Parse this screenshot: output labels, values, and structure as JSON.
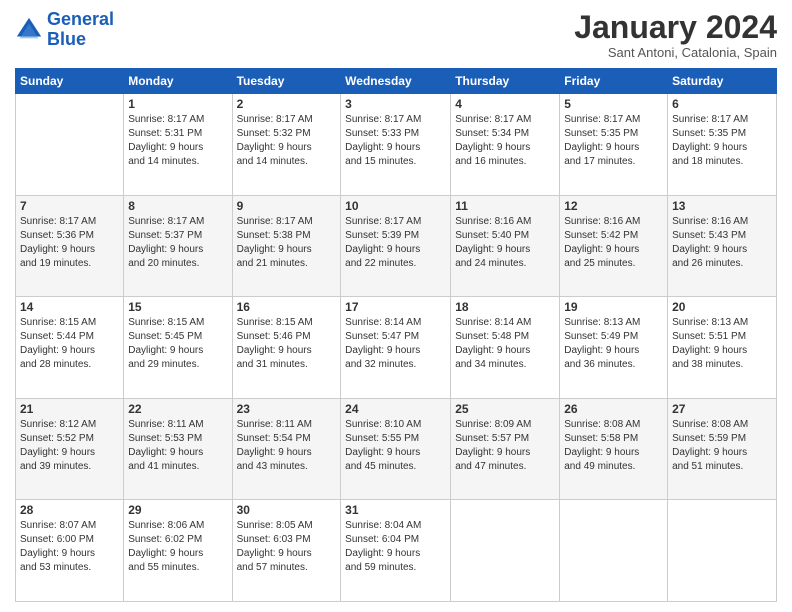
{
  "logo": {
    "line1": "General",
    "line2": "Blue"
  },
  "header": {
    "title": "January 2024",
    "location": "Sant Antoni, Catalonia, Spain"
  },
  "days_of_week": [
    "Sunday",
    "Monday",
    "Tuesday",
    "Wednesday",
    "Thursday",
    "Friday",
    "Saturday"
  ],
  "weeks": [
    [
      {
        "day": "",
        "info": ""
      },
      {
        "day": "1",
        "info": "Sunrise: 8:17 AM\nSunset: 5:31 PM\nDaylight: 9 hours\nand 14 minutes."
      },
      {
        "day": "2",
        "info": "Sunrise: 8:17 AM\nSunset: 5:32 PM\nDaylight: 9 hours\nand 14 minutes."
      },
      {
        "day": "3",
        "info": "Sunrise: 8:17 AM\nSunset: 5:33 PM\nDaylight: 9 hours\nand 15 minutes."
      },
      {
        "day": "4",
        "info": "Sunrise: 8:17 AM\nSunset: 5:34 PM\nDaylight: 9 hours\nand 16 minutes."
      },
      {
        "day": "5",
        "info": "Sunrise: 8:17 AM\nSunset: 5:35 PM\nDaylight: 9 hours\nand 17 minutes."
      },
      {
        "day": "6",
        "info": "Sunrise: 8:17 AM\nSunset: 5:35 PM\nDaylight: 9 hours\nand 18 minutes."
      }
    ],
    [
      {
        "day": "7",
        "info": "Sunrise: 8:17 AM\nSunset: 5:36 PM\nDaylight: 9 hours\nand 19 minutes."
      },
      {
        "day": "8",
        "info": "Sunrise: 8:17 AM\nSunset: 5:37 PM\nDaylight: 9 hours\nand 20 minutes."
      },
      {
        "day": "9",
        "info": "Sunrise: 8:17 AM\nSunset: 5:38 PM\nDaylight: 9 hours\nand 21 minutes."
      },
      {
        "day": "10",
        "info": "Sunrise: 8:17 AM\nSunset: 5:39 PM\nDaylight: 9 hours\nand 22 minutes."
      },
      {
        "day": "11",
        "info": "Sunrise: 8:16 AM\nSunset: 5:40 PM\nDaylight: 9 hours\nand 24 minutes."
      },
      {
        "day": "12",
        "info": "Sunrise: 8:16 AM\nSunset: 5:42 PM\nDaylight: 9 hours\nand 25 minutes."
      },
      {
        "day": "13",
        "info": "Sunrise: 8:16 AM\nSunset: 5:43 PM\nDaylight: 9 hours\nand 26 minutes."
      }
    ],
    [
      {
        "day": "14",
        "info": "Sunrise: 8:15 AM\nSunset: 5:44 PM\nDaylight: 9 hours\nand 28 minutes."
      },
      {
        "day": "15",
        "info": "Sunrise: 8:15 AM\nSunset: 5:45 PM\nDaylight: 9 hours\nand 29 minutes."
      },
      {
        "day": "16",
        "info": "Sunrise: 8:15 AM\nSunset: 5:46 PM\nDaylight: 9 hours\nand 31 minutes."
      },
      {
        "day": "17",
        "info": "Sunrise: 8:14 AM\nSunset: 5:47 PM\nDaylight: 9 hours\nand 32 minutes."
      },
      {
        "day": "18",
        "info": "Sunrise: 8:14 AM\nSunset: 5:48 PM\nDaylight: 9 hours\nand 34 minutes."
      },
      {
        "day": "19",
        "info": "Sunrise: 8:13 AM\nSunset: 5:49 PM\nDaylight: 9 hours\nand 36 minutes."
      },
      {
        "day": "20",
        "info": "Sunrise: 8:13 AM\nSunset: 5:51 PM\nDaylight: 9 hours\nand 38 minutes."
      }
    ],
    [
      {
        "day": "21",
        "info": "Sunrise: 8:12 AM\nSunset: 5:52 PM\nDaylight: 9 hours\nand 39 minutes."
      },
      {
        "day": "22",
        "info": "Sunrise: 8:11 AM\nSunset: 5:53 PM\nDaylight: 9 hours\nand 41 minutes."
      },
      {
        "day": "23",
        "info": "Sunrise: 8:11 AM\nSunset: 5:54 PM\nDaylight: 9 hours\nand 43 minutes."
      },
      {
        "day": "24",
        "info": "Sunrise: 8:10 AM\nSunset: 5:55 PM\nDaylight: 9 hours\nand 45 minutes."
      },
      {
        "day": "25",
        "info": "Sunrise: 8:09 AM\nSunset: 5:57 PM\nDaylight: 9 hours\nand 47 minutes."
      },
      {
        "day": "26",
        "info": "Sunrise: 8:08 AM\nSunset: 5:58 PM\nDaylight: 9 hours\nand 49 minutes."
      },
      {
        "day": "27",
        "info": "Sunrise: 8:08 AM\nSunset: 5:59 PM\nDaylight: 9 hours\nand 51 minutes."
      }
    ],
    [
      {
        "day": "28",
        "info": "Sunrise: 8:07 AM\nSunset: 6:00 PM\nDaylight: 9 hours\nand 53 minutes."
      },
      {
        "day": "29",
        "info": "Sunrise: 8:06 AM\nSunset: 6:02 PM\nDaylight: 9 hours\nand 55 minutes."
      },
      {
        "day": "30",
        "info": "Sunrise: 8:05 AM\nSunset: 6:03 PM\nDaylight: 9 hours\nand 57 minutes."
      },
      {
        "day": "31",
        "info": "Sunrise: 8:04 AM\nSunset: 6:04 PM\nDaylight: 9 hours\nand 59 minutes."
      },
      {
        "day": "",
        "info": ""
      },
      {
        "day": "",
        "info": ""
      },
      {
        "day": "",
        "info": ""
      }
    ]
  ]
}
